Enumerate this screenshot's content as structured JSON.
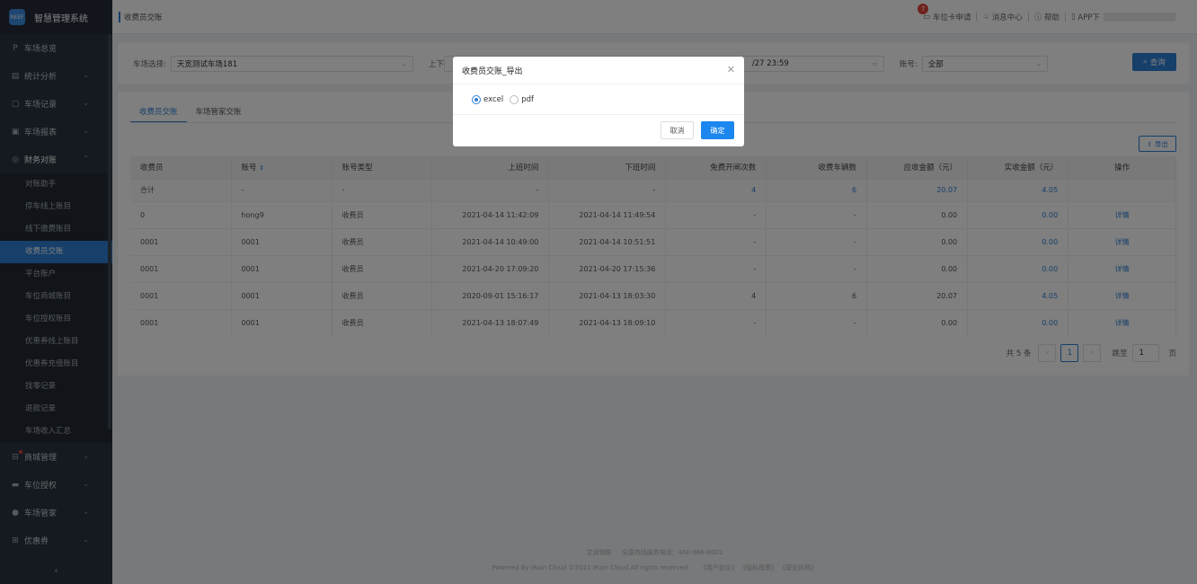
{
  "app": {
    "logo_mark": "REEF",
    "title": "智慧管理系统"
  },
  "header": {
    "breadcrumb": "收费员交账",
    "card_apply": "车位卡申请",
    "card_apply_badge": "7",
    "messages": "消息中心",
    "help": "帮助",
    "app_download": "APP下"
  },
  "sidebar": {
    "items": [
      {
        "label": "车场总览",
        "icon": "parking-icon"
      },
      {
        "label": "统计分析",
        "icon": "chart-icon"
      },
      {
        "label": "车场记录",
        "icon": "record-icon"
      },
      {
        "label": "车场报表",
        "icon": "report-icon"
      },
      {
        "label": "财务对账",
        "icon": "finance-icon"
      }
    ],
    "finance_sub": [
      "对账助手",
      "停车线上账目",
      "线下缴费账目",
      "收费员交账",
      "平台账户",
      "车位商城账目",
      "车位授权账目",
      "优惠券线上账目",
      "优惠券充值账目",
      "找零记录",
      "退款记录",
      "车场收入汇总"
    ],
    "after_items": [
      {
        "label": "商城管理",
        "icon": "mall-icon"
      },
      {
        "label": "车位授权",
        "icon": "car-icon"
      },
      {
        "label": "车场管家",
        "icon": "user-icon"
      },
      {
        "label": "优惠券",
        "icon": "coupon-icon"
      }
    ],
    "collapse": "‹"
  },
  "filters": {
    "lot_label": "车场选择:",
    "lot_value": "天宽测试车场181",
    "time_label": "上下",
    "time_end": "/27 23:59",
    "account_label": "账号:",
    "account_value": "全部",
    "query_button": "查询"
  },
  "tabs": [
    "收费员交账",
    "车场管家交账"
  ],
  "export_button": "导出",
  "table": {
    "headers": [
      "收费员",
      "账号",
      "账号类型",
      "上班时间",
      "下班时间",
      "免费开闸次数",
      "收费车辆数",
      "应收金额（元）",
      "实收金额（元）",
      "操作"
    ],
    "sum_row": [
      "合计",
      "-",
      "-",
      "-",
      "-",
      "4",
      "6",
      "20.07",
      "4.05",
      ""
    ],
    "rows": [
      [
        "0",
        "hong9",
        "收费员",
        "2021-04-14 11:42:09",
        "2021-04-14 11:49:54",
        "-",
        "-",
        "0.00",
        "0.00",
        "详情"
      ],
      [
        "0001",
        "0001",
        "收费员",
        "2021-04-14 10:49:00",
        "2021-04-14 10:51:51",
        "-",
        "-",
        "0.00",
        "0.00",
        "详情"
      ],
      [
        "0001",
        "0001",
        "收费员",
        "2021-04-20 17:09:20",
        "2021-04-20 17:15:36",
        "-",
        "-",
        "0.00",
        "0.00",
        "详情"
      ],
      [
        "0001",
        "0001",
        "收费员",
        "2020-09-01 15:16:17",
        "2021-04-13 18:03:30",
        "4",
        "6",
        "20.07",
        "4.05",
        "详情"
      ],
      [
        "0001",
        "0001",
        "收费员",
        "2021-04-13 18:07:49",
        "2021-04-13 18:09:10",
        "-",
        "-",
        "0.00",
        "0.00",
        "详情"
      ]
    ]
  },
  "pager": {
    "total": "共 5 条",
    "current": "1",
    "goto_label": "跳至",
    "goto_value": "1",
    "page_suffix": "页"
  },
  "footer": {
    "line1_brand": "艾润物联",
    "line1_hotline": "全国热线服务电话：400-966-8001",
    "line2_powered": "Powered By iRain Cloud ©2021 iRain Cloud.All rights reserved.",
    "line2_links": "《用户协议》 《隐私政策》 《营业执照》"
  },
  "modal": {
    "title": "收费员交账_导出",
    "options": [
      "excel",
      "pdf"
    ],
    "selected": "excel",
    "cancel": "取消",
    "confirm": "确定"
  },
  "colors": {
    "accent": "#2d7fd5",
    "sidebar_bg": "#2b3440",
    "danger": "#e0453a"
  }
}
